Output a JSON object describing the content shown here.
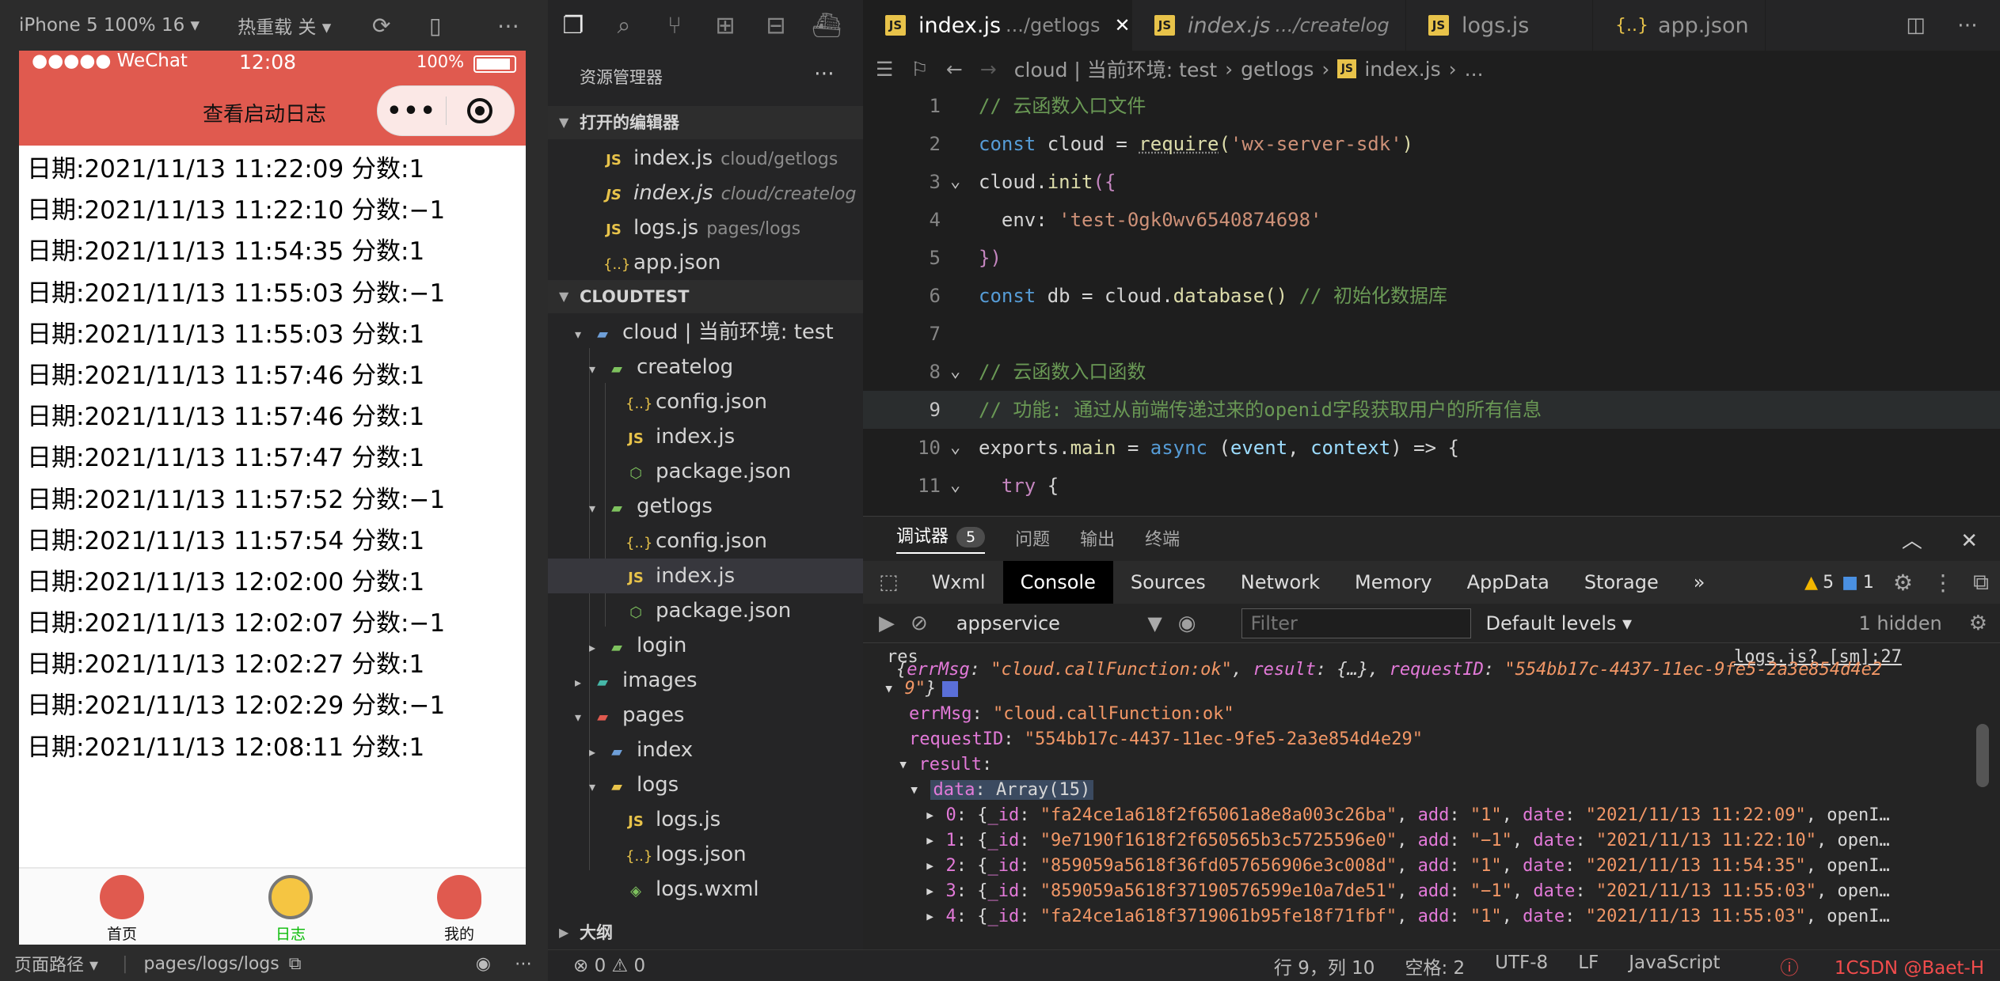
{
  "simulator": {
    "device": "iPhone 5 100% 16",
    "hot_reload": "热重载 关",
    "status_bar": {
      "carrier": "●●●●● WeChat",
      "time": "12:08",
      "battery": "100%"
    },
    "nav_title": "查看启动日志",
    "logs": [
      "日期:2021/11/13 11:22:09 分数:1",
      "日期:2021/11/13 11:22:10 分数:−1",
      "日期:2021/11/13 11:54:35 分数:1",
      "日期:2021/11/13 11:55:03 分数:−1",
      "日期:2021/11/13 11:55:03 分数:1",
      "日期:2021/11/13 11:57:46 分数:1",
      "日期:2021/11/13 11:57:46 分数:1",
      "日期:2021/11/13 11:57:47 分数:1",
      "日期:2021/11/13 11:57:52 分数:−1",
      "日期:2021/11/13 11:57:54 分数:1",
      "日期:2021/11/13 12:02:00 分数:1",
      "日期:2021/11/13 12:02:07 分数:−1",
      "日期:2021/11/13 12:02:27 分数:1",
      "日期:2021/11/13 12:02:29 分数:−1",
      "日期:2021/11/13 12:08:11 分数:1"
    ],
    "tabs": {
      "home": "首页",
      "log": "日志",
      "mine": "我的"
    },
    "bottom": {
      "page_path_label": "页面路径",
      "page_path": "pages/logs/logs"
    }
  },
  "explorer": {
    "title": "资源管理器",
    "open_editors_label": "打开的编辑器",
    "open_editors": [
      {
        "name": "index.js",
        "path": "cloud/getlogs"
      },
      {
        "name": "index.js",
        "path": "cloud/createlog"
      },
      {
        "name": "logs.js",
        "path": "pages/logs"
      },
      {
        "name": "app.json",
        "path": ""
      }
    ],
    "project_label": "CLOUDTEST",
    "tree": {
      "cloud": "cloud | 当前环境: test",
      "createlog": "createlog",
      "createlog_config": "config.json",
      "createlog_index": "index.js",
      "createlog_package": "package.json",
      "getlogs": "getlogs",
      "getlogs_config": "config.json",
      "getlogs_index": "index.js",
      "getlogs_package": "package.json",
      "login": "login",
      "images": "images",
      "pages": "pages",
      "index": "index",
      "logs": "logs",
      "logs_js": "logs.js",
      "logs_json": "logs.json",
      "logs_wxml": "logs.wxml"
    },
    "outline_label": "大纲"
  },
  "editor": {
    "tabs": [
      {
        "label": "index.js",
        "sub": ".../getlogs",
        "close": "✕"
      },
      {
        "label": "index.js",
        "sub": ".../createlog"
      },
      {
        "label": "logs.js"
      },
      {
        "label": "app.json"
      }
    ],
    "breadcrumb": {
      "root": "cloud | 当前环境: test",
      "folder": "getlogs",
      "file": "index.js",
      "rest": "..."
    },
    "line_numbers": [
      "1",
      "2",
      "3",
      "4",
      "5",
      "6",
      "7",
      "8",
      "9",
      "10",
      "11"
    ],
    "code": {
      "l1": "// 云函数入口文件",
      "l2_kw": "const",
      "l2_name": " cloud = ",
      "l2_fn": "require",
      "l2_p1": "(",
      "l2_str": "'wx-server-sdk'",
      "l2_p2": ")",
      "l3_obj": "cloud.",
      "l3_fn": "init",
      "l3_rest": "({",
      "l4_key": "  env: ",
      "l4_str": "'test-0gk0wv6540874698'",
      "l5": "})",
      "l6_kw": "const",
      "l6_name": " db = cloud.",
      "l6_fn": "database",
      "l6_p": "() ",
      "l6_cm": "// 初始化数据库",
      "l8": "// 云函数入口函数",
      "l9": "// 功能: 通过从前端传递过来的openid字段获取用户的所有信息",
      "l10_obj": "exports.",
      "l10_fn": "main",
      "l10_eq": " = ",
      "l10_kw": "async",
      "l10_p1": " (",
      "l10_a1": "event",
      "l10_c": ", ",
      "l10_a2": "context",
      "l10_end": ") => {",
      "l11_kw": "  try",
      "l11_end": " {"
    }
  },
  "debugger": {
    "tabs": [
      "调试器",
      "问题",
      "输出",
      "终端"
    ],
    "badge": "5",
    "devtools_tabs": [
      "Wxml",
      "Console",
      "Sources",
      "Network",
      "Memory",
      "AppData",
      "Storage",
      "»"
    ],
    "warnings": "5",
    "infos": "1",
    "context": "appservice",
    "filter_placeholder": "Filter",
    "levels": "Default levels",
    "hidden": "1 hidden",
    "source_link": "logs.js? [sm]:27",
    "console": {
      "res": "res",
      "obj_a": "{",
      "obj_k1": "errMsg",
      "obj_v1": "\"cloud.callFunction:ok\"",
      "obj_k2": "result",
      "obj_v2": "{…}",
      "obj_k3": "requestID",
      "obj_v3a": "\"554bb17c-4437-11ec-9fe5-2a3e854d4e2",
      "obj_v3b": "9\"",
      "obj_close": "}",
      "errMsg_key": "errMsg",
      "errMsg_val": "\"cloud.callFunction:ok\"",
      "reqid_key": "requestID",
      "reqid_val": "\"554bb17c-4437-11ec-9fe5-2a3e854d4e29\"",
      "result_key": "result",
      "data_key": "data",
      "data_val": "Array(15)",
      "items": [
        {
          "idx": "0",
          "id": "\"fa24ce1a618f2f65061a8e8a003c26ba\"",
          "add": "\"1\"",
          "date": "\"2021/11/13 11:22:09\"",
          "tail": ", openI…"
        },
        {
          "idx": "1",
          "id": "\"9e7190f1618f2f650565b3c5725596e0\"",
          "add": "\"−1\"",
          "date": "\"2021/11/13 11:22:10\"",
          "tail": ", open…"
        },
        {
          "idx": "2",
          "id": "\"859059a5618f36fd057656906e3c008d\"",
          "add": "\"1\"",
          "date": "\"2021/11/13 11:54:35\"",
          "tail": ", openI…"
        },
        {
          "idx": "3",
          "id": "\"859059a5618f37190576599e10a7de51\"",
          "add": "\"−1\"",
          "date": "\"2021/11/13 11:55:03\"",
          "tail": ", open…"
        },
        {
          "idx": "4",
          "id": "\"fa24ce1a618f3719061b95fe18f71fbf\"",
          "add": "\"1\"",
          "date": "\"2021/11/13 11:55:03\"",
          "tail": ", openI…"
        }
      ]
    }
  },
  "statusbar": {
    "problems": "⊗ 0 ⚠ 0",
    "position": "行 9，列 10",
    "spaces": "空格: 2",
    "encoding": "UTF-8",
    "eol": "LF",
    "language": "JavaScript",
    "errors": "1CSDN @Baet-H"
  },
  "colors": {
    "accent": "#e05a4f",
    "editor_bg": "#1e1e1e",
    "sidebar_bg": "#252526"
  }
}
